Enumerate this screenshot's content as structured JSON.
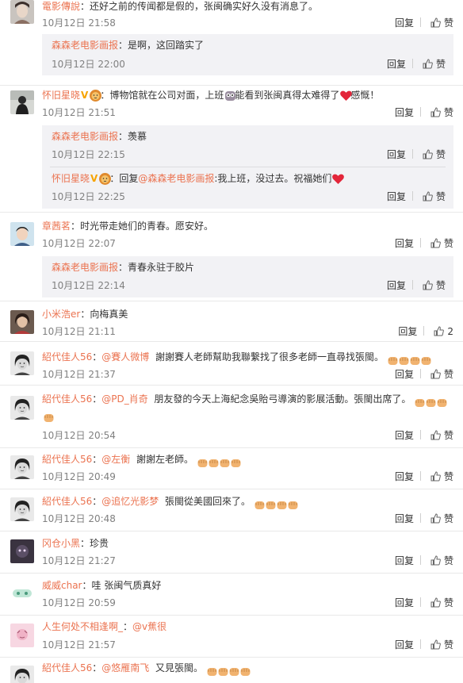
{
  "ui": {
    "reply_label": "回复",
    "like_label": "赞",
    "colon": ":",
    "colon_cn": "："
  },
  "colors": {
    "username": "#eb7350",
    "text": "#333333",
    "time": "#808080",
    "reply_bg": "#f2f2f5"
  },
  "comments": [
    {
      "user": "電影傳說",
      "text": "还好之前的传闻都是假的，张闽确实好久没有消息了。",
      "time": "10月12日 21:58",
      "avatar": "avatar-woman-icon",
      "replies": [
        {
          "user": "森森老电影画报",
          "text": "是啊，这回踏实了",
          "time": "10月12日 22:00"
        }
      ]
    },
    {
      "user": "怀旧星晓",
      "text_a": "博物馆就在公司对面，上班",
      "text_b": "能看到张闽真得太难得了",
      "text_c": "感慨！",
      "time": "10月12日 21:51",
      "avatar": "avatar-silhouette-icon",
      "replies": [
        {
          "user": "森森老电影画报",
          "text": "羡慕",
          "time": "10月12日 22:15"
        },
        {
          "user": "怀旧星晓",
          "prefix": "回复",
          "mention": "@森森老电影画报",
          "text": ":我上班，没过去。祝福她们",
          "time": "10月12日 22:25"
        }
      ]
    },
    {
      "user": "章茜茗",
      "text": "时光带走她们的青春。愿安好。",
      "time": "10月12日 22:07",
      "avatar": "avatar-boy-icon",
      "replies": [
        {
          "user": "森森老电影画报",
          "text": "青春永驻于胶片",
          "time": "10月12日 22:14"
        }
      ]
    },
    {
      "user": "小米浩er",
      "text": "向梅真美",
      "time": "10月12日 21:11",
      "avatar": "avatar-woman-portrait-icon",
      "like_count": "2"
    },
    {
      "user": "紹代佳人56",
      "mention": "@賽人微博",
      "text": "謝謝賽人老師幫助我聯繫找了很多老師一直尋找張閩。",
      "time": "10月12日 21:37",
      "avatar": "avatar-vintage-portrait-icon",
      "emoji_count": 4
    },
    {
      "user": "紹代佳人56",
      "mention": "@PD_肖奇",
      "text": "朋友發的今天上海紀念吳貽弓導演的影展活動。張閩出席了。",
      "time": "10月12日 20:54",
      "avatar": "avatar-vintage-portrait-icon",
      "emoji_count": 4
    },
    {
      "user": "紹代佳人56",
      "mention": "@左衡",
      "text": "謝謝左老師。",
      "time": "10月12日 20:49",
      "avatar": "avatar-vintage-portrait-icon",
      "emoji_count": 4
    },
    {
      "user": "紹代佳人56",
      "mention": "@追忆光影梦",
      "text": "張閩從美國回來了。",
      "time": "10月12日 20:48",
      "avatar": "avatar-vintage-portrait-icon",
      "emoji_count": 4
    },
    {
      "user": "冈仓小黑",
      "text": "珍贵",
      "time": "10月12日 21:27",
      "avatar": "avatar-dark-icon"
    },
    {
      "user": "威威char",
      "text": "哇 张闽气质真好",
      "time": "10月12日 20:59",
      "avatar": "avatar-cartoon-icon"
    },
    {
      "user": "人生何处不相逢啊_",
      "mention": "@v蕉很",
      "text": "",
      "time": "10月12日 21:57",
      "avatar": "avatar-pink-icon"
    },
    {
      "user": "紹代佳人56",
      "mention": "@悠雁南飞",
      "text": "又見張閩。",
      "avatar": "avatar-vintage-portrait-icon",
      "emoji_count": 4
    }
  ]
}
